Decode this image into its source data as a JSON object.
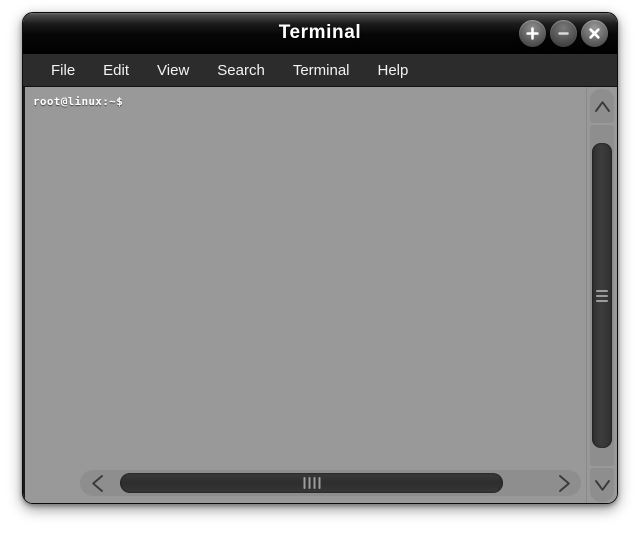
{
  "window": {
    "title": "Terminal",
    "controls": [
      {
        "name": "maximize-button",
        "icon": "plus-icon",
        "label": "+"
      },
      {
        "name": "minimize-button",
        "icon": "minus-icon",
        "label": "−"
      },
      {
        "name": "close-button",
        "icon": "close-icon",
        "label": "✕"
      }
    ]
  },
  "menubar": {
    "items": [
      {
        "label": "File"
      },
      {
        "label": "Edit"
      },
      {
        "label": "View"
      },
      {
        "label": "Search"
      },
      {
        "label": "Terminal"
      },
      {
        "label": "Help"
      }
    ]
  },
  "terminal": {
    "prompt": "root@linux:~$",
    "lines": [
      "root@linux:~$"
    ],
    "background_color": "#999999",
    "text_color": "#ffffff"
  },
  "scrollbars": {
    "vertical": {
      "up_arrow_icon": "chevron-up-icon",
      "down_arrow_icon": "chevron-down-icon",
      "thumb_name": "vertical-scroll-thumb",
      "grip_lines": 3
    },
    "horizontal": {
      "left_arrow_icon": "chevron-left-icon",
      "right_arrow_icon": "chevron-right-icon",
      "thumb_name": "horizontal-scroll-thumb",
      "grip_lines": 4
    }
  },
  "colors": {
    "titlebar": "#000000",
    "menubar": "#2c2c2c",
    "screen": "#999999",
    "scrollbar_track": "#8e8e8e",
    "scrollbar_thumb": "#303030"
  }
}
